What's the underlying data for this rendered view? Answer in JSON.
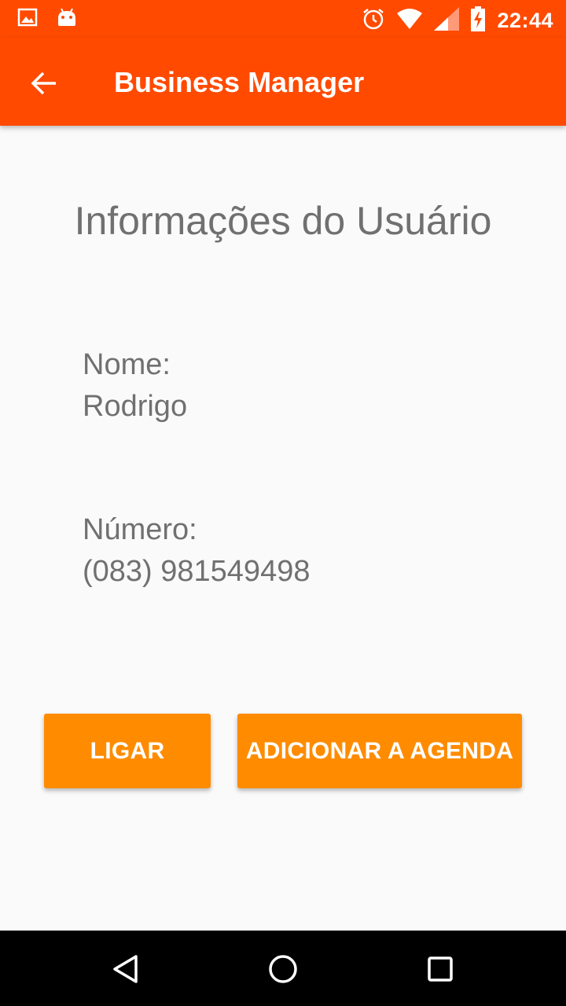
{
  "status_bar": {
    "time": "22:44",
    "icons": [
      "image-icon",
      "android-icon",
      "alarm-icon",
      "wifi-icon",
      "signal-icon",
      "battery-charging-icon"
    ]
  },
  "app_bar": {
    "title": "Business Manager",
    "back_icon": "arrow-back-icon"
  },
  "main": {
    "section_title": "Informações do Usuário",
    "name_label": "Nome:",
    "name_value": "Rodrigo",
    "number_label": "Número:",
    "number_value": "(083) 981549498",
    "call_button": "LIGAR",
    "add_button": "ADICIONAR A AGENDA"
  },
  "nav_bar": {
    "icons": [
      "back-triangle-icon",
      "home-circle-icon",
      "recents-square-icon"
    ]
  },
  "colors": {
    "primary": "#ff4a00",
    "accent": "#ff8c00",
    "text": "#707070",
    "background": "#fafafa"
  }
}
